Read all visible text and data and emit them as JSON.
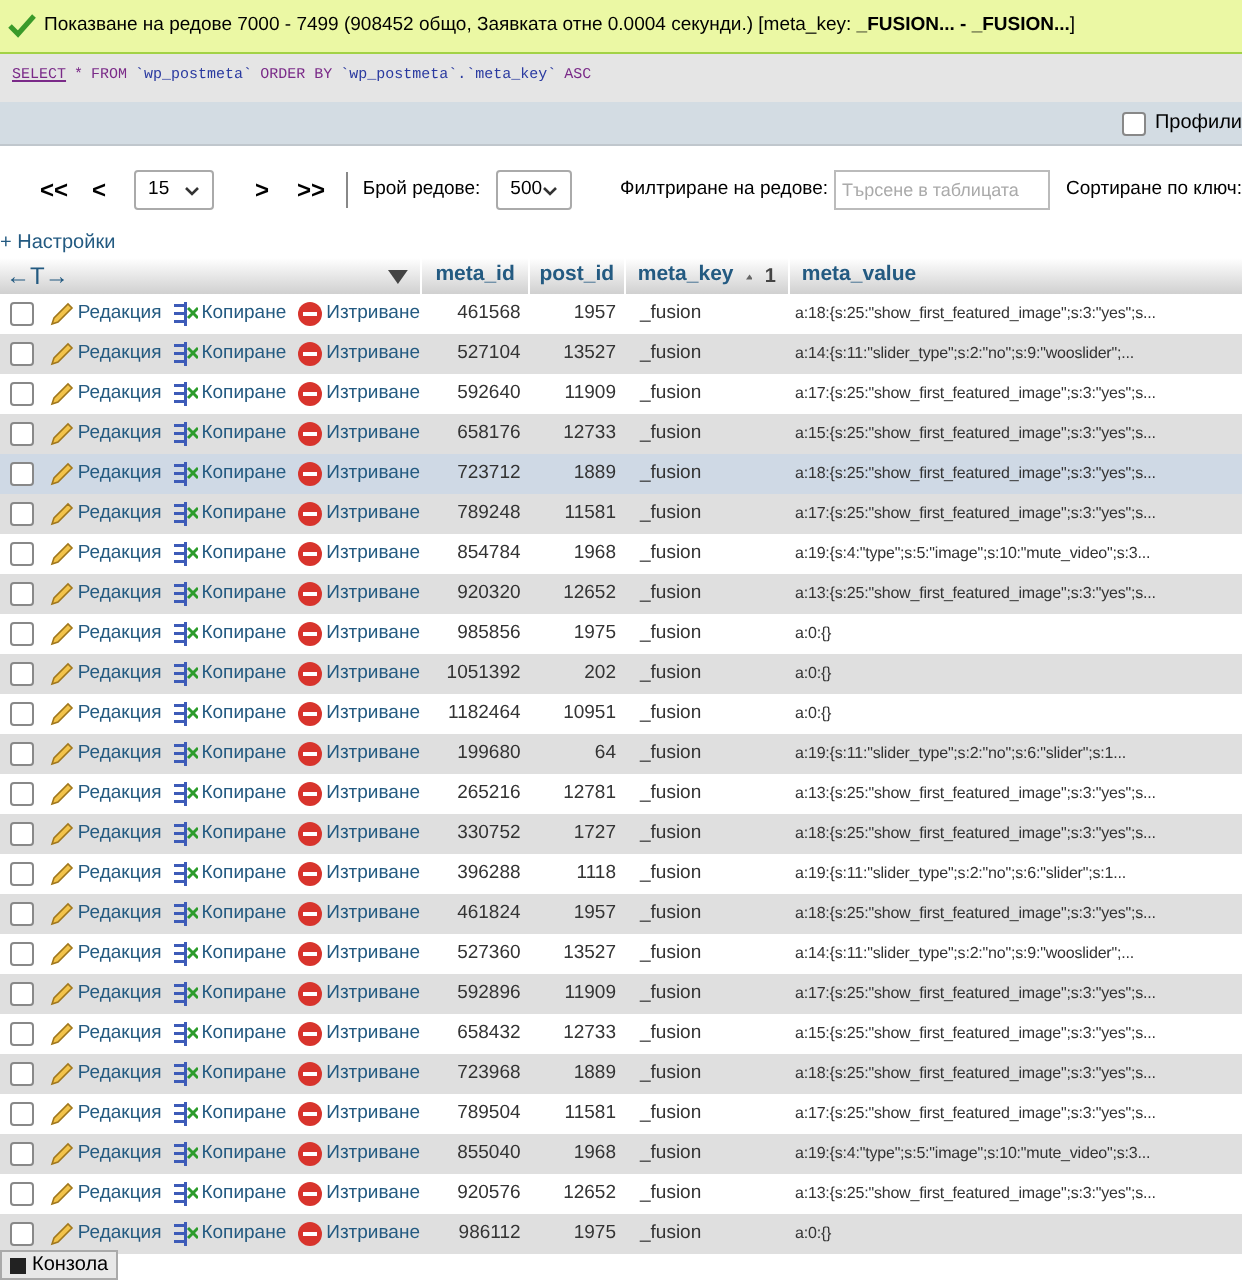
{
  "notice": {
    "text": "Показване на редове 7000 - 7499 (908452 общо, Заявката отне 0.0004 секунди.) [meta_key: **_FUSION... - _FUSION...**]"
  },
  "sql": [
    {
      "text": "SELECT",
      "kind": "link"
    },
    {
      "text": "*",
      "kind": "keyword"
    },
    {
      "text": "FROM",
      "kind": "keyword"
    },
    {
      "text": "`wp_postmeta`",
      "kind": "identifier"
    },
    {
      "text": "ORDER BY",
      "kind": "keyword"
    },
    {
      "text": "`wp_postmeta`.`meta_key`",
      "kind": "identifier"
    },
    {
      "text": "ASC",
      "kind": "keyword"
    }
  ],
  "profiling": {
    "label": "Профили",
    "checked": false
  },
  "pager": {
    "first": "<<",
    "prev": "<",
    "page": "15",
    "next": ">",
    "last": ">>",
    "rows_label": "Брой редове:",
    "rows": "500",
    "filter_label": "Филтриране на редове:",
    "filter_placeholder": "Търсене в таблицата",
    "sort_label": "Сортиране по ключ:"
  },
  "options_link": "+ Настройки",
  "table": {
    "arrows": "←T→",
    "columns": [
      {
        "label": "meta_id"
      },
      {
        "label": "post_id"
      },
      {
        "label": "meta_key",
        "sort": "1"
      },
      {
        "label": "meta_value"
      }
    ],
    "rows": [
      {
        "edit": "Редакция",
        "copy": "Копиране",
        "delete": "Изтриване",
        "meta_id": "461568",
        "post_id": "1957",
        "meta_key": "_fusion",
        "meta_value": "a:18:{s:25:\"show_first_featured_image\";s:3:\"yes\";s...",
        "checked": false,
        "highlighted": false
      },
      {
        "edit": "Редакция",
        "copy": "Копиране",
        "delete": "Изтриване",
        "meta_id": "527104",
        "post_id": "13527",
        "meta_key": "_fusion",
        "meta_value": "a:14:{s:11:\"slider_type\";s:2:\"no\";s:9:\"wooslider\";...",
        "checked": false,
        "highlighted": false
      },
      {
        "edit": "Редакция",
        "copy": "Копиране",
        "delete": "Изтриване",
        "meta_id": "592640",
        "post_id": "11909",
        "meta_key": "_fusion",
        "meta_value": "a:17:{s:25:\"show_first_featured_image\";s:3:\"yes\";s...",
        "checked": false,
        "highlighted": false
      },
      {
        "edit": "Редакция",
        "copy": "Копиране",
        "delete": "Изтриване",
        "meta_id": "658176",
        "post_id": "12733",
        "meta_key": "_fusion",
        "meta_value": "a:15:{s:25:\"show_first_featured_image\";s:3:\"yes\";s...",
        "checked": false,
        "highlighted": false
      },
      {
        "edit": "Редакция",
        "copy": "Копиране",
        "delete": "Изтриване",
        "meta_id": "723712",
        "post_id": "1889",
        "meta_key": "_fusion",
        "meta_value": "a:18:{s:25:\"show_first_featured_image\";s:3:\"yes\";s...",
        "checked": false,
        "highlighted": true
      },
      {
        "edit": "Редакция",
        "copy": "Копиране",
        "delete": "Изтриване",
        "meta_id": "789248",
        "post_id": "11581",
        "meta_key": "_fusion",
        "meta_value": "a:17:{s:25:\"show_first_featured_image\";s:3:\"yes\";s...",
        "checked": false,
        "highlighted": false
      },
      {
        "edit": "Редакция",
        "copy": "Копиране",
        "delete": "Изтриване",
        "meta_id": "854784",
        "post_id": "1968",
        "meta_key": "_fusion",
        "meta_value": "a:19:{s:4:\"type\";s:5:\"image\";s:10:\"mute_video\";s:3...",
        "checked": false,
        "highlighted": false
      },
      {
        "edit": "Редакция",
        "copy": "Копиране",
        "delete": "Изтриване",
        "meta_id": "920320",
        "post_id": "12652",
        "meta_key": "_fusion",
        "meta_value": "a:13:{s:25:\"show_first_featured_image\";s:3:\"yes\";s...",
        "checked": false,
        "highlighted": false
      },
      {
        "edit": "Редакция",
        "copy": "Копиране",
        "delete": "Изтриване",
        "meta_id": "985856",
        "post_id": "1975",
        "meta_key": "_fusion",
        "meta_value": "a:0:{}",
        "checked": false,
        "highlighted": false
      },
      {
        "edit": "Редакция",
        "copy": "Копиране",
        "delete": "Изтриване",
        "meta_id": "1051392",
        "post_id": "202",
        "meta_key": "_fusion",
        "meta_value": "a:0:{}",
        "checked": false,
        "highlighted": false
      },
      {
        "edit": "Редакция",
        "copy": "Копиране",
        "delete": "Изтриване",
        "meta_id": "1182464",
        "post_id": "10951",
        "meta_key": "_fusion",
        "meta_value": "a:0:{}",
        "checked": false,
        "highlighted": false
      },
      {
        "edit": "Редакция",
        "copy": "Копиране",
        "delete": "Изтриване",
        "meta_id": "199680",
        "post_id": "64",
        "meta_key": "_fusion",
        "meta_value": "a:19:{s:11:\"slider_type\";s:2:\"no\";s:6:\"slider\";s:1...",
        "checked": false,
        "highlighted": false
      },
      {
        "edit": "Редакция",
        "copy": "Копиране",
        "delete": "Изтриване",
        "meta_id": "265216",
        "post_id": "12781",
        "meta_key": "_fusion",
        "meta_value": "a:13:{s:25:\"show_first_featured_image\";s:3:\"yes\";s...",
        "checked": false,
        "highlighted": false
      },
      {
        "edit": "Редакция",
        "copy": "Копиране",
        "delete": "Изтриване",
        "meta_id": "330752",
        "post_id": "1727",
        "meta_key": "_fusion",
        "meta_value": "a:18:{s:25:\"show_first_featured_image\";s:3:\"yes\";s...",
        "checked": false,
        "highlighted": false
      },
      {
        "edit": "Редакция",
        "copy": "Копиране",
        "delete": "Изтриване",
        "meta_id": "396288",
        "post_id": "1118",
        "meta_key": "_fusion",
        "meta_value": "a:19:{s:11:\"slider_type\";s:2:\"no\";s:6:\"slider\";s:1...",
        "checked": false,
        "highlighted": false
      },
      {
        "edit": "Редакция",
        "copy": "Копиране",
        "delete": "Изтриване",
        "meta_id": "461824",
        "post_id": "1957",
        "meta_key": "_fusion",
        "meta_value": "a:18:{s:25:\"show_first_featured_image\";s:3:\"yes\";s...",
        "checked": false,
        "highlighted": false
      },
      {
        "edit": "Редакция",
        "copy": "Копиране",
        "delete": "Изтриване",
        "meta_id": "527360",
        "post_id": "13527",
        "meta_key": "_fusion",
        "meta_value": "a:14:{s:11:\"slider_type\";s:2:\"no\";s:9:\"wooslider\";...",
        "checked": false,
        "highlighted": false
      },
      {
        "edit": "Редакция",
        "copy": "Копиране",
        "delete": "Изтриване",
        "meta_id": "592896",
        "post_id": "11909",
        "meta_key": "_fusion",
        "meta_value": "a:17:{s:25:\"show_first_featured_image\";s:3:\"yes\";s...",
        "checked": false,
        "highlighted": false
      },
      {
        "edit": "Редакция",
        "copy": "Копиране",
        "delete": "Изтриване",
        "meta_id": "658432",
        "post_id": "12733",
        "meta_key": "_fusion",
        "meta_value": "a:15:{s:25:\"show_first_featured_image\";s:3:\"yes\";s...",
        "checked": false,
        "highlighted": false
      },
      {
        "edit": "Редакция",
        "copy": "Копиране",
        "delete": "Изтриване",
        "meta_id": "723968",
        "post_id": "1889",
        "meta_key": "_fusion",
        "meta_value": "a:18:{s:25:\"show_first_featured_image\";s:3:\"yes\";s...",
        "checked": false,
        "highlighted": false
      },
      {
        "edit": "Редакция",
        "copy": "Копиране",
        "delete": "Изтриване",
        "meta_id": "789504",
        "post_id": "11581",
        "meta_key": "_fusion",
        "meta_value": "a:17:{s:25:\"show_first_featured_image\";s:3:\"yes\";s...",
        "checked": false,
        "highlighted": false
      },
      {
        "edit": "Редакция",
        "copy": "Копиране",
        "delete": "Изтриване",
        "meta_id": "855040",
        "post_id": "1968",
        "meta_key": "_fusion",
        "meta_value": "a:19:{s:4:\"type\";s:5:\"image\";s:10:\"mute_video\";s:3...",
        "checked": false,
        "highlighted": false
      },
      {
        "edit": "Редакция",
        "copy": "Копиране",
        "delete": "Изтриване",
        "meta_id": "920576",
        "post_id": "12652",
        "meta_key": "_fusion",
        "meta_value": "a:13:{s:25:\"show_first_featured_image\";s:3:\"yes\";s...",
        "checked": false,
        "highlighted": false
      },
      {
        "edit": "Редакция",
        "copy": "Копиране",
        "delete": "Изтриване",
        "meta_id": "986112",
        "post_id": "1975",
        "meta_key": "_fusion",
        "meta_value": "a:0:{}",
        "checked": false,
        "highlighted": false
      }
    ]
  },
  "console": {
    "label": "Конзола"
  }
}
